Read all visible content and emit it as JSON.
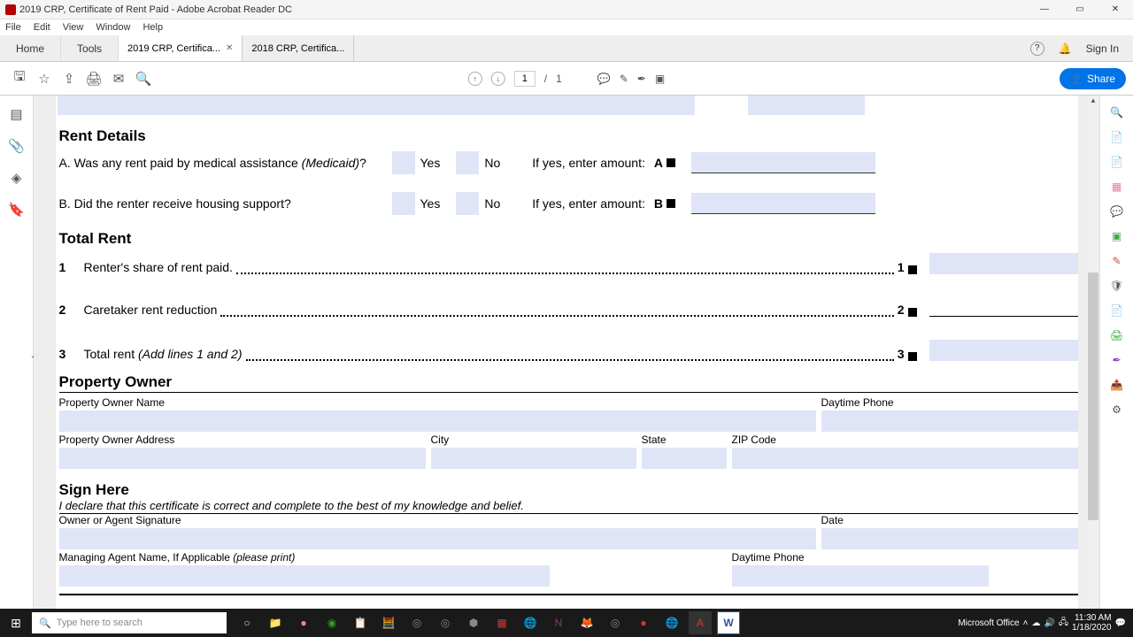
{
  "window": {
    "title": "2019 CRP, Certificate of Rent Paid - Adobe Acrobat Reader DC",
    "menus": [
      "File",
      "Edit",
      "View",
      "Window",
      "Help"
    ]
  },
  "tabs": {
    "home": "Home",
    "tools": "Tools",
    "doc1": "2019 CRP, Certifica...",
    "doc2": "2018 CRP, Certifica...",
    "signin": "Sign In"
  },
  "toolbar": {
    "page_current": "1",
    "page_sep": "/",
    "page_total": "1",
    "share": "Share"
  },
  "form": {
    "rent_details": {
      "heading": "Rent Details",
      "q_a_pre": "A. Was any rent paid by medical assistance ",
      "q_a_ital": "(Medicaid)",
      "q_a_post": "?",
      "q_b": "B. Did the renter receive housing support?",
      "yes": "Yes",
      "no": "No",
      "if_yes": "If yes, enter amount:",
      "marker_a": "A",
      "marker_b": "B"
    },
    "total_rent": {
      "heading": "Total Rent",
      "n1": "1",
      "t1": "Renter's share of rent paid.",
      "m1": "1",
      "n2": "2",
      "t2": "Caretaker rent reduction",
      "m2": "2",
      "n3": "3",
      "t3_pre": "Total rent ",
      "t3_ital": "(Add lines 1 and 2)",
      "m3": "3"
    },
    "owner": {
      "heading": "Property Owner",
      "name": "Property Owner Name",
      "phone": "Daytime Phone",
      "address": "Property Owner Address",
      "city": "City",
      "state": "State",
      "zip": "ZIP Code"
    },
    "sign": {
      "heading": "Sign Here",
      "declare": "I declare that this certificate is correct and complete to the best of my knowledge and belief.",
      "sig": "Owner or Agent Signature",
      "date": "Date",
      "agent_pre": "Managing Agent Name, If Applicable ",
      "agent_ital": "(please print)",
      "phone": "Daytime Phone"
    }
  },
  "taskbar": {
    "search_placeholder": "Type here to search",
    "office": "Microsoft Office",
    "time": "11:30 AM",
    "date": "1/18/2020"
  }
}
